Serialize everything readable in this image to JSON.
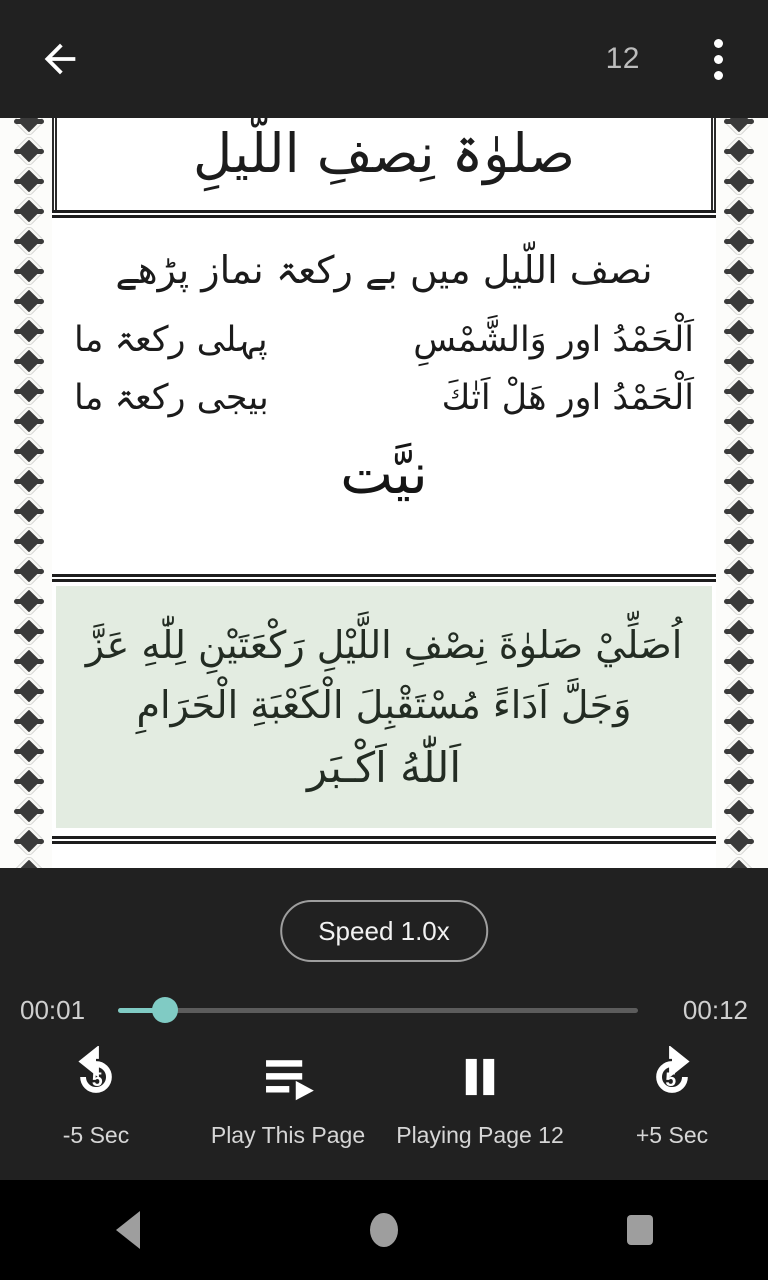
{
  "topbar": {
    "back_icon": "arrow-back-icon",
    "page_number": "12",
    "menu_icon": "overflow-menu-icon"
  },
  "scan_page": {
    "heading": "صلوٰۃ نِصفِ اللَّیلِ",
    "line_1": "نصف اللّیل میں بے رکعۃ نماز پڑھے",
    "line_2_right": "پہلی رکعۃ ما",
    "line_2_left": "اَلْحَمْدُ اور وَالشَّمْسِ",
    "line_3_right": "بیجی رکعۃ ما",
    "line_3_left": "اَلْحَمْدُ اور هَلْ اَتٰكَ",
    "section_title": "نیَّت",
    "highlight_line_1": "اُصَلِّيْ صَلوٰةَ نِصْفِ اللَّيْلِ رَكْعَتَيْنِ لِلّٰهِ عَزَّ",
    "highlight_line_2": "وَجَلَّ اَدَاءً مُسْتَقْبِلَ الْكَعْبَةِ الْحَرَامِ",
    "highlight_line_3": "اَللّٰهُ اَكْـبَر",
    "highlight_color": "#e3ece1"
  },
  "player": {
    "speed_label": "Speed 1.0x",
    "time_current": "00:01",
    "time_total": "00:12",
    "progress_percent": 9,
    "accent_color": "#80cbc4",
    "controls": [
      {
        "icon": "replay-5-icon",
        "label": "-5 Sec",
        "badge": "5"
      },
      {
        "icon": "playlist-play-icon",
        "label": "Play This Page",
        "badge": ""
      },
      {
        "icon": "pause-icon",
        "label": "Playing Page 12",
        "badge": ""
      },
      {
        "icon": "forward-5-icon",
        "label": "+5 Sec",
        "badge": "5"
      }
    ]
  },
  "navbar": {
    "back_icon": "nav-back-icon",
    "home_icon": "nav-home-icon",
    "recents_icon": "nav-recents-icon"
  }
}
